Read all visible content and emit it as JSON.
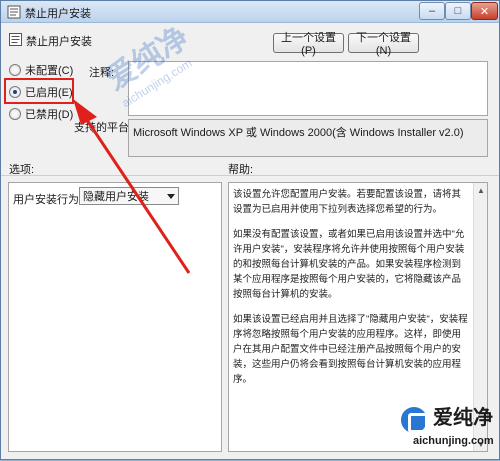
{
  "window": {
    "title": "禁止用户安装",
    "controls": {
      "minimize": "–",
      "maximize": "□",
      "close": "✕"
    }
  },
  "header": {
    "policy_name": "禁止用户安装",
    "prev_button": "上一个设置(P)",
    "next_button": "下一个设置(N)"
  },
  "state": {
    "options": [
      {
        "label": "未配置(C)",
        "checked": false
      },
      {
        "label": "已启用(E)",
        "checked": true
      },
      {
        "label": "已禁用(D)",
        "checked": false
      }
    ]
  },
  "comment": {
    "label": "注释:",
    "value": ""
  },
  "platform": {
    "label": "支持的平台:",
    "value": "Microsoft Windows XP 或 Windows 2000(含 Windows Installer v2.0)"
  },
  "sections": {
    "options_label": "选项:",
    "help_label": "帮助:"
  },
  "options_pane": {
    "field_label": "用户安装行为:",
    "selected_value": "隐藏用户安装"
  },
  "help": {
    "paragraphs": [
      "该设置允许您配置用户安装。若要配置该设置，请将其设置为已启用并使用下拉列表选择您希望的行为。",
      "如果没有配置该设置，或者如果已启用该设置并选中\"允许用户安装\"，安装程序将允许并使用按照每个用户安装的和按照每台计算机安装的产品。如果安装程序检测到某个应用程序是按照每个用户安装的，它将隐藏该产品按照每台计算机的安装。",
      "如果该设置已经启用并且选择了\"隐藏用户安装\"，安装程序将忽略按照每个用户安装的应用程序。这样，即使用户在其用户配置文件中已经注册产品按照每个用户的安装，这些用户仍将会看到按照每台计算机安装的应用程序。"
    ]
  },
  "watermark": {
    "center_cn": "爱纯净",
    "center_en": "aichunjing.com",
    "corner_cn": "爱纯净",
    "corner_en": "aichunjing.com"
  },
  "colors": {
    "highlight": "#e0201c",
    "arrow": "#e0201c",
    "selection": "#1e3f8a"
  }
}
